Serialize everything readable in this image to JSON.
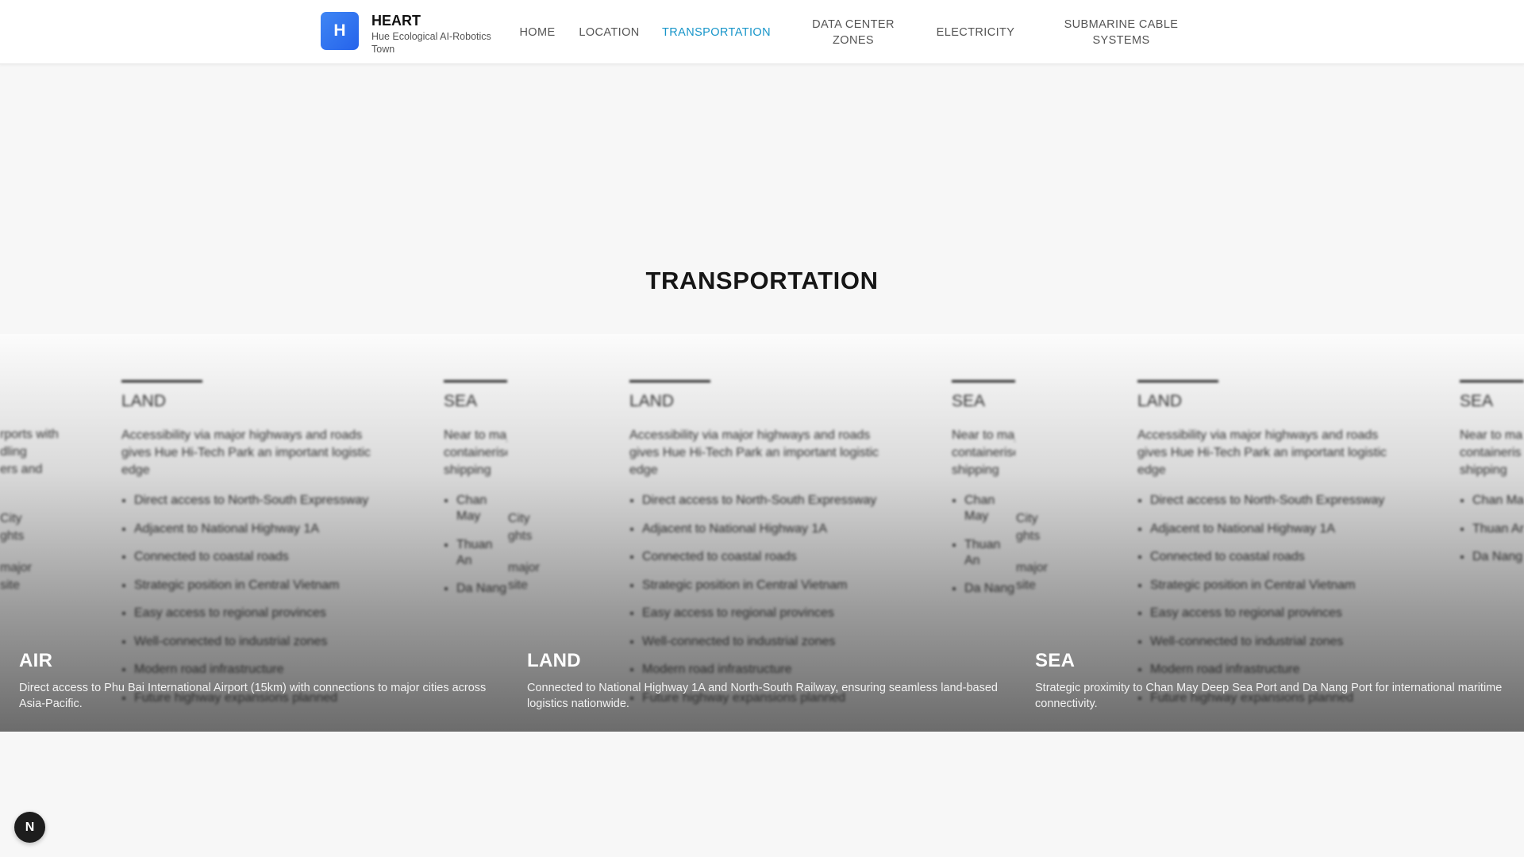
{
  "brand": {
    "logo_letter": "H",
    "name": "HEART",
    "tagline": "Hue Ecological AI-Robotics Town"
  },
  "nav": [
    {
      "label": "HOME",
      "active": false
    },
    {
      "label": "LOCATION",
      "active": false
    },
    {
      "label": "TRANSPORTATION",
      "active": true
    },
    {
      "label": "DATA CENTER ZONES",
      "active": false
    },
    {
      "label": "ELECTRICITY",
      "active": false
    },
    {
      "label": "SUBMARINE CABLE SYSTEMS",
      "active": false
    }
  ],
  "section": {
    "title": "TRANSPORTATION"
  },
  "background_cards": {
    "land": {
      "title": "LAND",
      "description": "Accessibility via major highways and roads gives Hue Hi-Tech Park an important logistic edge",
      "items": [
        "Direct access to North-South Expressway",
        "Adjacent to National Highway 1A",
        "Connected to coastal roads",
        "Strategic position in Central Vietnam",
        "Easy access to regional provinces",
        "Well-connected to industrial zones",
        "Modern road infrastructure",
        "Future highway expansions planned"
      ]
    },
    "sea": {
      "title": "SEA",
      "description": "Near to major ports with containerised handling shipping",
      "items": [
        "Chan May",
        "Thuan An",
        "Da Nang"
      ]
    },
    "fragments": {
      "ports_with": "rports with",
      "dling": "dling",
      "ers_and": "ers and",
      "city": "City",
      "ghts": "ghts",
      "major": "major",
      "site": "site",
      "near_to_ma": "Near to ma",
      "containeris": "containeris",
      "shipping": "shipping",
      "chan_ma": "Chan Ma",
      "thuan_an": "Thuan An",
      "da_nang": "Da Nang"
    }
  },
  "overlays": [
    {
      "title": "AIR",
      "text": "Direct access to Phu Bai International Airport (15km) with connections to major cities across Asia-Pacific."
    },
    {
      "title": "LAND",
      "text": "Connected to National Highway 1A and North-South Railway, ensuring seamless land-based logistics nationwide."
    },
    {
      "title": "SEA",
      "text": "Strategic proximity to Chan May Deep Sea Port and Da Nang Port for international maritime connectivity."
    }
  ],
  "fab": {
    "letter": "N"
  }
}
